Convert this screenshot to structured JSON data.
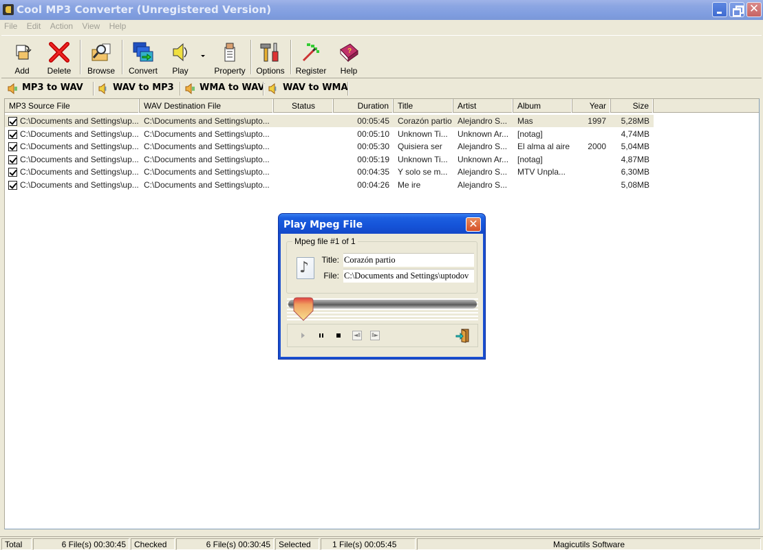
{
  "window": {
    "title": "Cool MP3 Converter (Unregistered Version)",
    "controls": {
      "minimize": "minimize",
      "restore": "restore",
      "close": "✕"
    }
  },
  "menu": [
    "File",
    "Edit",
    "Action",
    "View",
    "Help"
  ],
  "toolbar": {
    "add": "Add",
    "delete": "Delete",
    "browse": "Browse",
    "convert": "Convert",
    "play": "Play",
    "property": "Property",
    "options": "Options",
    "register": "Register",
    "help": "Help"
  },
  "tabs": [
    {
      "label": "MP3 to WAV",
      "active": true
    },
    {
      "label": "WAV to MP3",
      "active": false
    },
    {
      "label": "WMA to WAV",
      "active": false
    },
    {
      "label": "WAV to WMA",
      "active": false
    }
  ],
  "list": {
    "columns": [
      "MP3 Source File",
      "WAV Destination File",
      "Status",
      "Duration",
      "Title",
      "Artist",
      "Album",
      "Year",
      "Size"
    ],
    "rows": [
      {
        "checked": true,
        "source": "C:\\Documents and Settings\\up...",
        "dest": "C:\\Documents and Settings\\upto...",
        "status": "",
        "duration": "00:05:45",
        "title": "Corazón partio",
        "artist": "Alejandro S...",
        "album": "Mas",
        "year": "1997",
        "size": "5,28MB",
        "selected": true
      },
      {
        "checked": true,
        "source": "C:\\Documents and Settings\\up...",
        "dest": "C:\\Documents and Settings\\upto...",
        "status": "",
        "duration": "00:05:10",
        "title": "Unknown Ti...",
        "artist": "Unknown Ar...",
        "album": "[notag]",
        "year": "",
        "size": "4,74MB",
        "selected": false
      },
      {
        "checked": true,
        "source": "C:\\Documents and Settings\\up...",
        "dest": "C:\\Documents and Settings\\upto...",
        "status": "",
        "duration": "00:05:30",
        "title": "Quisiera ser",
        "artist": "Alejandro S...",
        "album": "El alma al aire",
        "year": "2000",
        "size": "5,04MB",
        "selected": false
      },
      {
        "checked": true,
        "source": "C:\\Documents and Settings\\up...",
        "dest": "C:\\Documents and Settings\\upto...",
        "status": "",
        "duration": "00:05:19",
        "title": "Unknown Ti...",
        "artist": "Unknown Ar...",
        "album": "[notag]",
        "year": "",
        "size": "4,87MB",
        "selected": false
      },
      {
        "checked": true,
        "source": "C:\\Documents and Settings\\up...",
        "dest": "C:\\Documents and Settings\\upto...",
        "status": "",
        "duration": "00:04:35",
        "title": "Y solo se m...",
        "artist": "Alejandro S...",
        "album": "MTV Unpla...",
        "year": "",
        "size": "6,30MB",
        "selected": false
      },
      {
        "checked": true,
        "source": "C:\\Documents and Settings\\up...",
        "dest": "C:\\Documents and Settings\\upto...",
        "status": "",
        "duration": "00:04:26",
        "title": "Me ire",
        "artist": "Alejandro S...",
        "album": "",
        "year": "",
        "size": "5,08MB",
        "selected": false
      }
    ]
  },
  "dialog": {
    "title": "Play Mpeg File",
    "close": "✕",
    "group_label": "Mpeg file #1 of 1",
    "title_label": "Title:",
    "title_value": "Corazón partio",
    "file_label": "File:",
    "file_value": "C:\\Documents and Settings\\uptodov",
    "seek_position": 0.0,
    "buttons": {
      "prev": "◄Ⅱ",
      "next": "Ⅱ►"
    }
  },
  "statusbar": {
    "total_label": "Total",
    "total_value": "6 File(s)   00:30:45",
    "checked_label": "Checked",
    "checked_value": "6 File(s)   00:30:45",
    "selected_label": "Selected",
    "selected_value": "1 File(s)   00:05:45",
    "company": "Magicutils Software"
  },
  "colors": {
    "titlebar": "#8ca6e2",
    "dialog_titlebar": "#1553d8",
    "face": "#ece9d8",
    "selected_row": "#ece9d8"
  }
}
